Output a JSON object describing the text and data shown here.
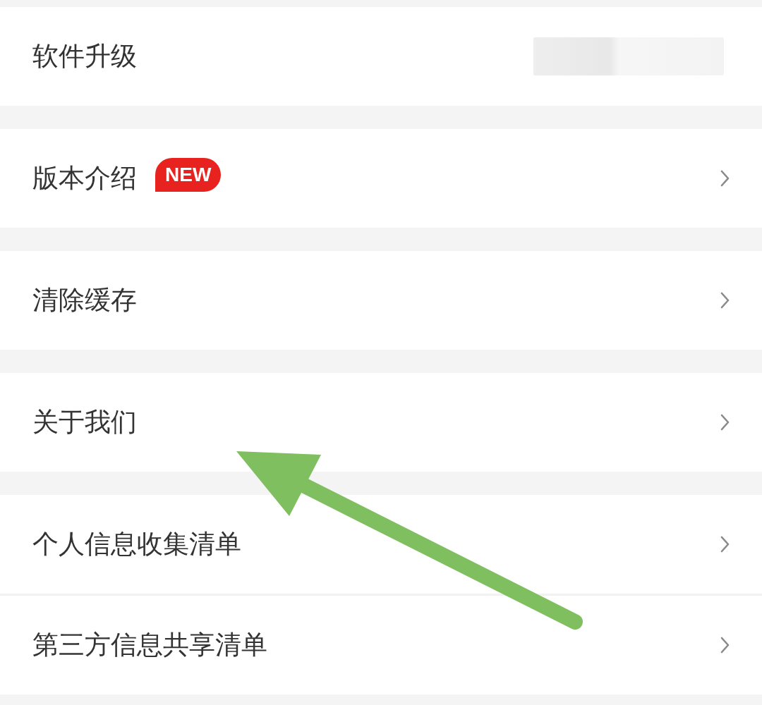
{
  "groups": [
    {
      "items": [
        {
          "label": "软件升级",
          "kind": "blurred"
        }
      ]
    },
    {
      "items": [
        {
          "label": "版本介绍",
          "kind": "link",
          "badge": "NEW"
        }
      ]
    },
    {
      "items": [
        {
          "label": "清除缓存",
          "kind": "link"
        }
      ]
    },
    {
      "items": [
        {
          "label": "关于我们",
          "kind": "link"
        }
      ]
    },
    {
      "items": [
        {
          "label": "个人信息收集清单",
          "kind": "link"
        },
        {
          "label": "第三方信息共享清单",
          "kind": "link"
        }
      ]
    }
  ],
  "annotation": {
    "kind": "arrow"
  }
}
